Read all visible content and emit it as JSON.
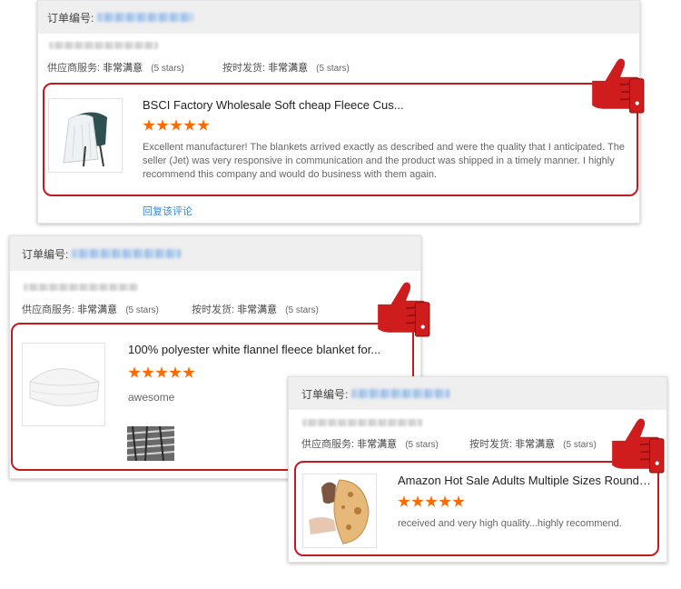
{
  "labels": {
    "order_no": "订单编号:",
    "supplier_service": "供应商服务:",
    "on_time_delivery": "按时发货:",
    "very_satisfied": "非常满意",
    "five_stars": "(5 stars)",
    "reply_review": "回复该评论"
  },
  "colors": {
    "accent_red": "#c4191f",
    "star_orange": "#ff6a00",
    "link_blue": "#3a86d6"
  },
  "rating_stars": 5,
  "reviews": [
    {
      "product_title": "BSCI Factory Wholesale Soft cheap Fleece Cus...",
      "text": "Excellent manufacturer! The blankets arrived exactly as described and were the quality that I anticipated. The seller (Jet) was very responsive in communication and the product was shipped in a timely manner. I highly recommend this company and would do business with them again.",
      "image": "blanket-on-chair",
      "icon": "thumbs-up-icon"
    },
    {
      "product_title": "100% polyester white flannel fleece blanket for...",
      "text": "awesome",
      "image": "folded-white-blanket",
      "icon": "thumbs-up-icon"
    },
    {
      "product_title": "Amazon Hot Sale Adults Multiple Sizes Round ...",
      "text": "received and very high quality...highly recommend.",
      "image": "woman-in-tortilla-blanket",
      "icon": "thumbs-up-icon"
    }
  ]
}
